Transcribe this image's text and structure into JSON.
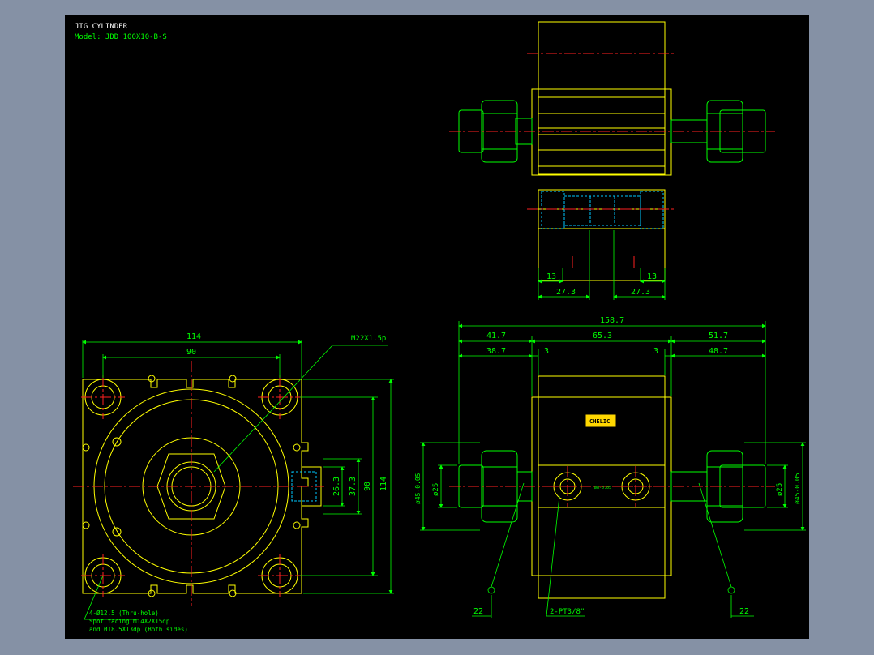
{
  "title": "JIG CYLINDER",
  "model": "Model: JDD 100X10-B-S",
  "colors": {
    "background": "#8591a5",
    "canvas": "#000000",
    "outline": "#ffff00",
    "fitting": "#00ff00",
    "centerline": "#ff2020",
    "hidden": "#00c8ff",
    "dimension": "#00ff00",
    "title": "#ffffff"
  },
  "top_view": {
    "dims": {
      "left_a": "13",
      "right_a": "13",
      "left_b": "27.3",
      "right_b": "27.3"
    }
  },
  "front_view": {
    "dims": {
      "overall_width": "114",
      "hole_pitch_h": "90",
      "hole_pitch_v": "90",
      "overall_height": "114",
      "port_a": "26.3",
      "port_b": "37.3"
    },
    "thread_label": "M22X1.5p",
    "note_lines": [
      "4-Ø12.5 (Thru-hole)",
      "Spot facing  M14X2X15dp",
      "and Ø18.5X13dp (Both sides)"
    ]
  },
  "side_view": {
    "dims": {
      "overall": "158.7",
      "left_outer": "41.7",
      "body": "65.3",
      "right_outer": "51.7",
      "left_inner": "38.7",
      "gap_left": "3",
      "gap_right": "3",
      "right_inner": "48.7",
      "dia_left_a": "ø45-0.05",
      "dia_left_b": "ø25",
      "dia_right_a": "ø25",
      "dia_right_b": "ø45-0.05",
      "bottom_left": "22",
      "bottom_right": "22"
    },
    "port_label": "2-PT3/8\"",
    "brand_label": "CHELIC",
    "center_tag": "ø8-0.05"
  }
}
